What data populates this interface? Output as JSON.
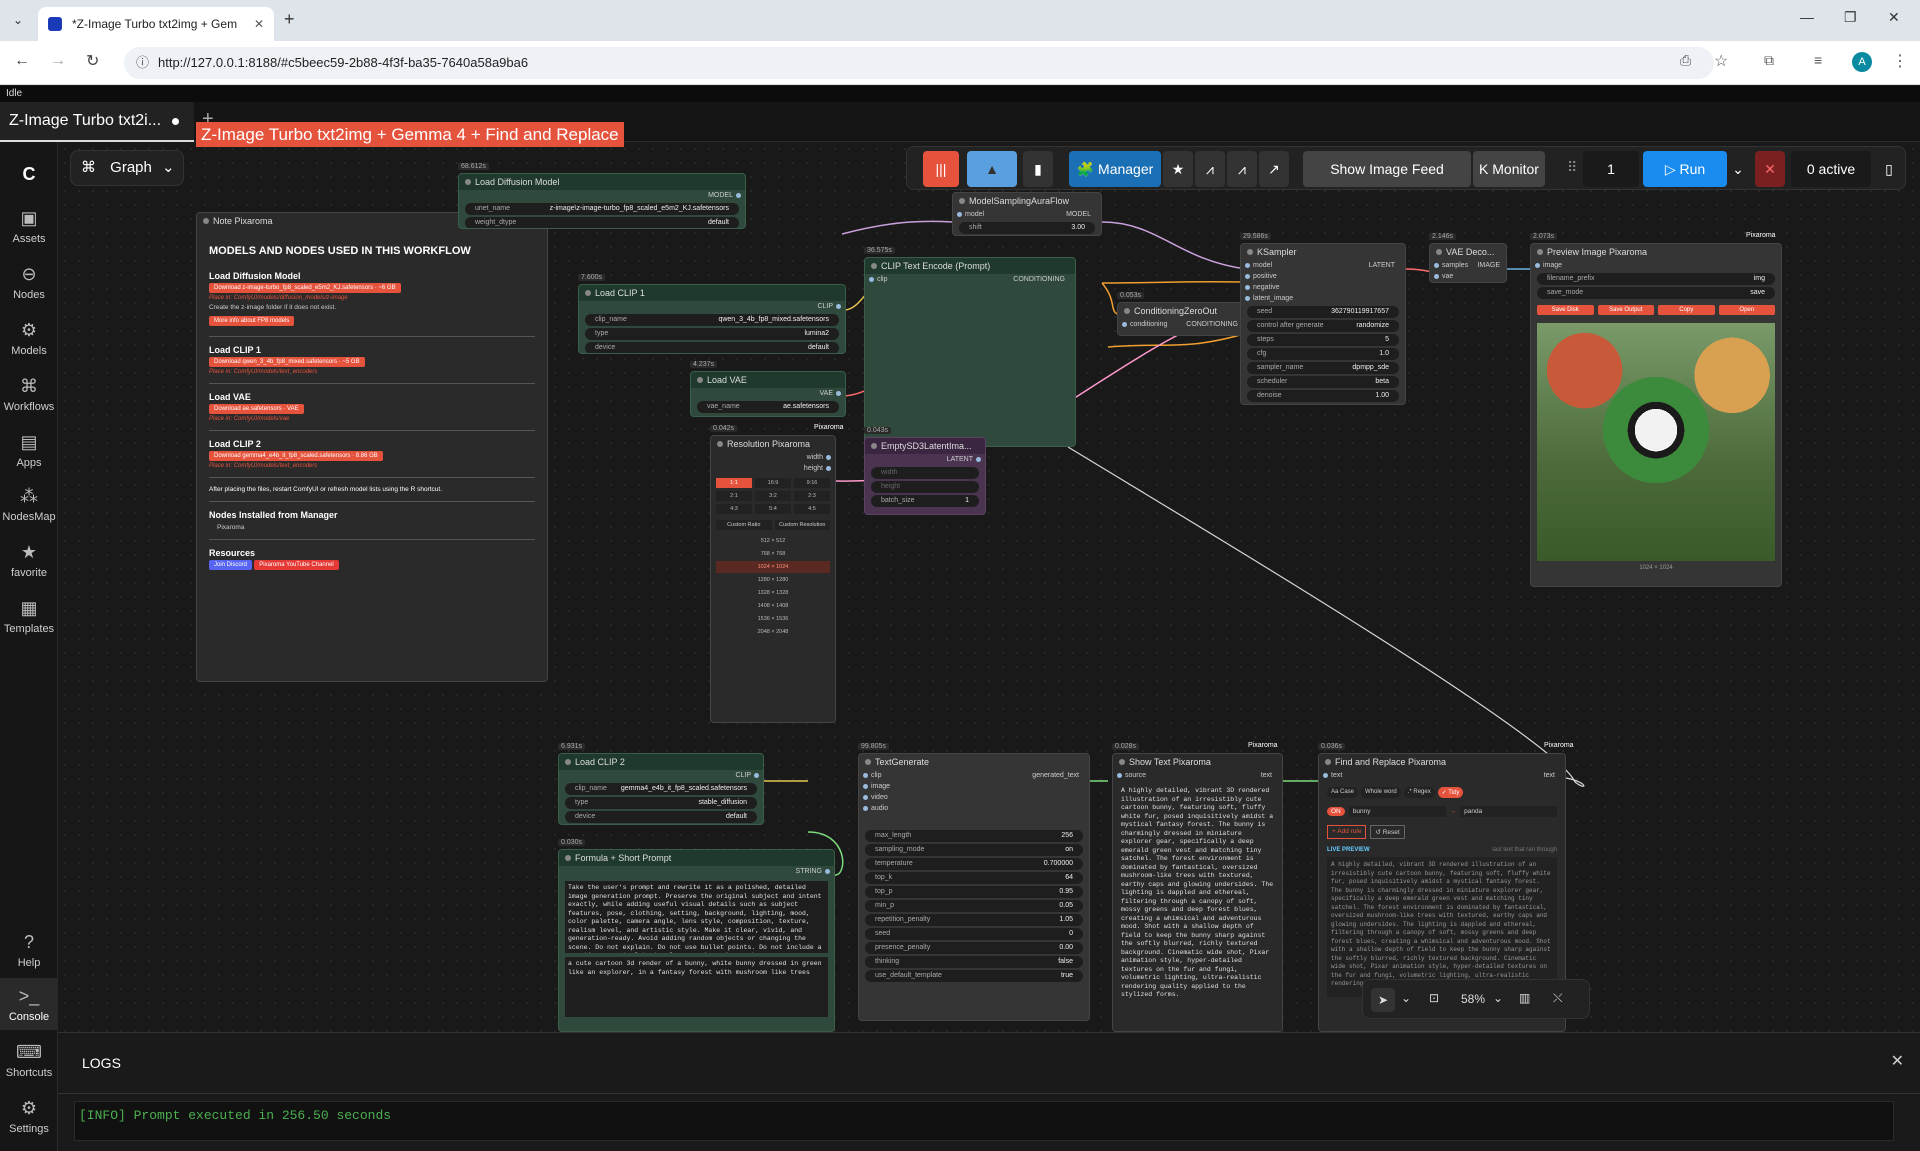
{
  "browser": {
    "tab_title": "*Z-Image Turbo txt2img + Gem",
    "url": "http://127.0.0.1:8188/#c5beec59-2b88-4f3f-ba35-7640a58a9ba6",
    "avatar": "A"
  },
  "status": "Idle",
  "workflow_tab": "Z-Image Turbo txt2i...",
  "graph_label": "Graph",
  "title_banner": "Z-Image Turbo txt2img + Gemma 4 + Find and Replace",
  "sidebar": [
    {
      "label": "Assets",
      "icon": "assets-icon"
    },
    {
      "label": "Nodes",
      "icon": "nodes-icon"
    },
    {
      "label": "Models",
      "icon": "models-icon"
    },
    {
      "label": "Workflows",
      "icon": "workflows-icon"
    },
    {
      "label": "Apps",
      "icon": "apps-icon"
    },
    {
      "label": "NodesMap",
      "icon": "nodesmap-icon"
    },
    {
      "label": "favorite",
      "icon": "star-icon"
    },
    {
      "label": "Templates",
      "icon": "templates-icon"
    },
    {
      "label": "Help",
      "icon": "help-icon"
    },
    {
      "label": "Console",
      "icon": "console-icon"
    },
    {
      "label": "Shortcuts",
      "icon": "keyboard-icon"
    },
    {
      "label": "Settings",
      "icon": "gear-icon"
    }
  ],
  "toolbar": {
    "manager": "Manager",
    "show_feed": "Show Image Feed",
    "monitor": "Monitor",
    "queue_count": "1",
    "run": "Run",
    "active": "0 active"
  },
  "note": {
    "header": "Note Pixaroma",
    "brand": "Pixaroma",
    "heading": "MODELS AND NODES USED IN THIS WORKFLOW",
    "s1": "Load Diffusion Model",
    "s1_btn": "Download z-image-turbo_fp8_scaled_e5m2_KJ.safetensors · ~6 GB",
    "s1_place": "Place in: ComfyUI/models/diffusion_models/z-image",
    "s1_note": "Create the z-image folder if it does not exist.",
    "s1_more": "More info about FP8 models",
    "s2": "Load CLIP 1",
    "s2_btn": "Download qwen_3_4b_fp8_mixed.safetensors · ~5 GB",
    "s2_place": "Place in: ComfyUI/models/text_encoders",
    "s3": "Load VAE",
    "s3_btn": "Download ae.safetensors · VAE",
    "s3_place": "Place in: ComfyUI/models/vae",
    "s4": "Load CLIP 2",
    "s4_btn": "Download gemma4_e4b_it_fp8_scaled.safetensors · 8.86 GB",
    "s4_place": "Place in: ComfyUI/models/text_encoders",
    "warn": "After placing the files, restart ComfyUI or refresh model lists using the R shortcut.",
    "s5": "Nodes Installed from Manager",
    "s5_item": "Pixaroma",
    "s6": "Resources",
    "r1": "Join Discord",
    "r2": "Pixaroma YouTube Channel"
  },
  "nodes": {
    "load_diff": {
      "t": "Load Diffusion Model",
      "time": "68.612s",
      "unet": "z-image\\z-image-turbo_fp8_scaled_e5m2_KJ.safetensors",
      "dtype": "default",
      "out": "MODEL"
    },
    "clip1": {
      "t": "Load CLIP 1",
      "time": "7.600s",
      "name": "qwen_3_4b_fp8_mixed.safetensors",
      "type": "lumina2",
      "device": "default",
      "out": "CLIP"
    },
    "vae": {
      "t": "Load VAE",
      "time": "4.237s",
      "name": "ae.safetensors",
      "out": "VAE"
    },
    "aura": {
      "t": "ModelSamplingAuraFlow",
      "in": "model",
      "out": "MODEL",
      "shift": "3.00"
    },
    "clipenc": {
      "t": "CLIP Text Encode (Prompt)",
      "time": "36.575s",
      "in": "clip",
      "out": "CONDITIONING"
    },
    "zero": {
      "t": "ConditioningZeroOut",
      "time": "0.053s",
      "in": "conditioning",
      "out": "CONDITIONING"
    },
    "ksampler": {
      "t": "KSampler",
      "time": "29.586s",
      "seed": "362790119917657",
      "cag": "randomize",
      "steps": "5",
      "cfg": "1.0",
      "sampler": "dpmpp_sde",
      "scheduler": "beta",
      "denoise": "1.00",
      "out": "LATENT"
    },
    "vaedec": {
      "t": "VAE Deco...",
      "time": "2.146s",
      "out": "IMAGE"
    },
    "preview": {
      "t": "Preview Image Pixaroma",
      "time": "2.073s",
      "prefix": "img",
      "save": "save",
      "b1": "Save Disk",
      "b2": "Save Output",
      "b3": "Copy",
      "b4": "Open",
      "res": "1024 × 1024"
    },
    "resolution": {
      "t": "Resolution Pixaroma",
      "time": "0.042s",
      "ratios": [
        "1:1",
        "16:9",
        "9:16",
        "2:1",
        "3:2",
        "2:3",
        "4:3",
        "5:4",
        "4:5"
      ],
      "custom1": "Custom Ratio",
      "custom2": "Custom Resolution",
      "sizes": [
        "512 × 512",
        "768 × 768",
        "1024 × 1024",
        "1280 × 1280",
        "1328 × 1328",
        "1408 × 1408",
        "1536 × 1536",
        "2048 × 2048"
      ]
    },
    "empty": {
      "t": "EmptySD3LatentIma...",
      "time": "0.043s",
      "batch": "1",
      "out": "LATENT"
    },
    "clip2": {
      "t": "Load CLIP 2",
      "time": "6.931s",
      "name": "gemma4_e4b_it_fp8_scaled.safetensors",
      "type": "stable_diffusion",
      "device": "default",
      "out": "CLIP"
    },
    "formula": {
      "t": "Formula + Short Prompt",
      "time": "0.030s",
      "out": "STRING",
      "text1": "Take the user's prompt and rewrite it as a polished, detailed image generation prompt. Preserve the original subject and intent exactly, while adding useful visual details such as subject features, pose, clothing, setting, background, lighting, mood, color palette, camera angle, lens style, composition, texture, realism level, and artistic style. Make it clear, vivid, and generation-ready. Avoid adding random objects or changing the scene. Do not explain. Do not use bullet points. Do not include a negative prompt. Output only one enhanced prompt:",
      "text2": "a cute cartoon 3d render of a bunny, white bunny dressed in green like an explorer, in a fantasy forest with mushroom like trees"
    },
    "textgen": {
      "t": "TextGenerate",
      "time": "99.805s",
      "max_length": "256",
      "sampling_mode": "on",
      "temperature": "0.700000",
      "top_k": "64",
      "top_p": "0.95",
      "min_p": "0.05",
      "repetition_penalty": "1.05",
      "seed": "0",
      "presence_penalty": "0.00",
      "thinking": "false",
      "use_default_template": "true"
    },
    "showtext": {
      "t": "Show Text Pixaroma",
      "time": "0.028s",
      "text": "A highly detailed, vibrant 3D rendered illustration of an irresistibly cute cartoon bunny, featuring soft, fluffy white fur, posed inquisitively amidst a mystical fantasy forest. The bunny is charmingly dressed in miniature explorer gear, specifically a deep emerald green vest and matching tiny satchel. The forest environment is dominated by fantastical, oversized mushroom-like trees with textured, earthy caps and glowing undersides. The lighting is dappled and ethereal, filtering through a canopy of soft, mossy greens and deep forest blues, creating a whimsical and adventurous mood. Shot with a shallow depth of field to keep the bunny sharp against the softly blurred, richly textured background. Cinematic wide shot, Pixar animation style, hyper-detailed textures on the fur and fungi, volumetric lighting, ultra-realistic rendering quality applied to the stylized forms."
    },
    "findrep": {
      "t": "Find and Replace Pixaroma",
      "time": "0.036s",
      "aa": "Aa Case",
      "whole": "Whole word",
      "regex": ".* Regex",
      "tidy": "✓ Tidy",
      "find": "bunny",
      "replace": "panda",
      "on": "ON",
      "add": "+ Add rule",
      "reset": "↺ Reset",
      "live": "LIVE PREVIEW",
      "hint": "last text that ran through"
    }
  },
  "zoom": "58%",
  "logs": {
    "title": "LOGS",
    "line": "[INFO] Prompt executed in 256.50 seconds"
  }
}
